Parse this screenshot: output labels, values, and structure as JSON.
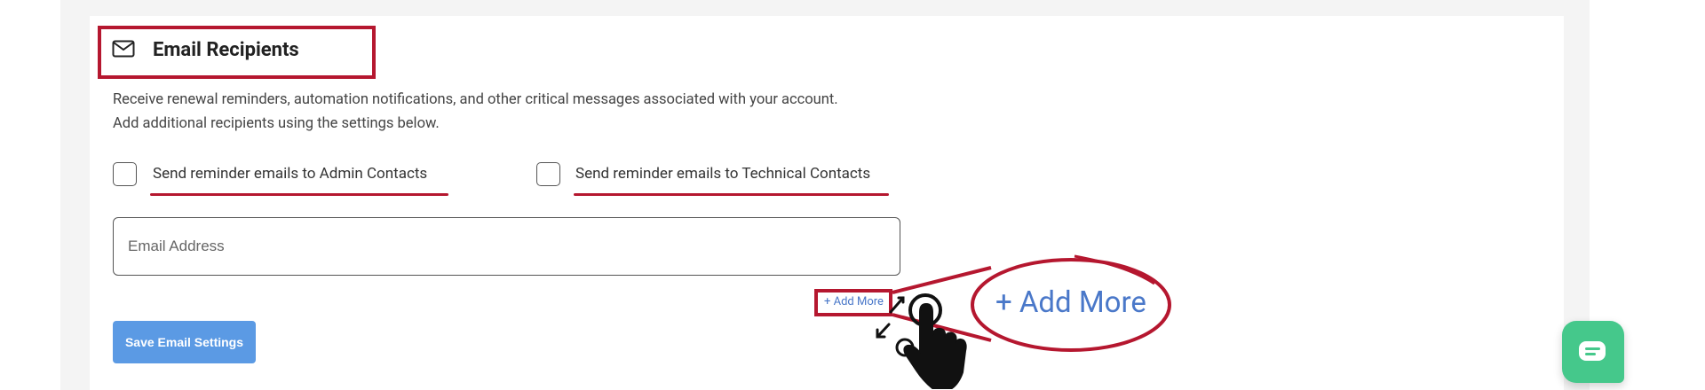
{
  "section": {
    "title": "Email Recipients",
    "icon": "envelope-icon",
    "description_line1": "Receive renewal reminders, automation notifications, and other critical messages associated with your account.",
    "description_line2": "Add additional recipients using the settings below."
  },
  "checkboxes": {
    "admin_label": "Send reminder emails to Admin Contacts",
    "admin_checked": false,
    "technical_label": "Send reminder emails to Technical Contacts",
    "technical_checked": false
  },
  "email_field": {
    "placeholder": "Email Address",
    "value": ""
  },
  "add_more": {
    "label": "+ Add More",
    "zoom_label": "+ Add More"
  },
  "save_button": {
    "label": "Save Email Settings"
  },
  "chat": {
    "icon": "chat-bubble-icon"
  },
  "colors": {
    "highlight": "#b5172f",
    "primary_button": "#5b9ae4",
    "link": "#4a78c9",
    "chat": "#45c88b"
  }
}
